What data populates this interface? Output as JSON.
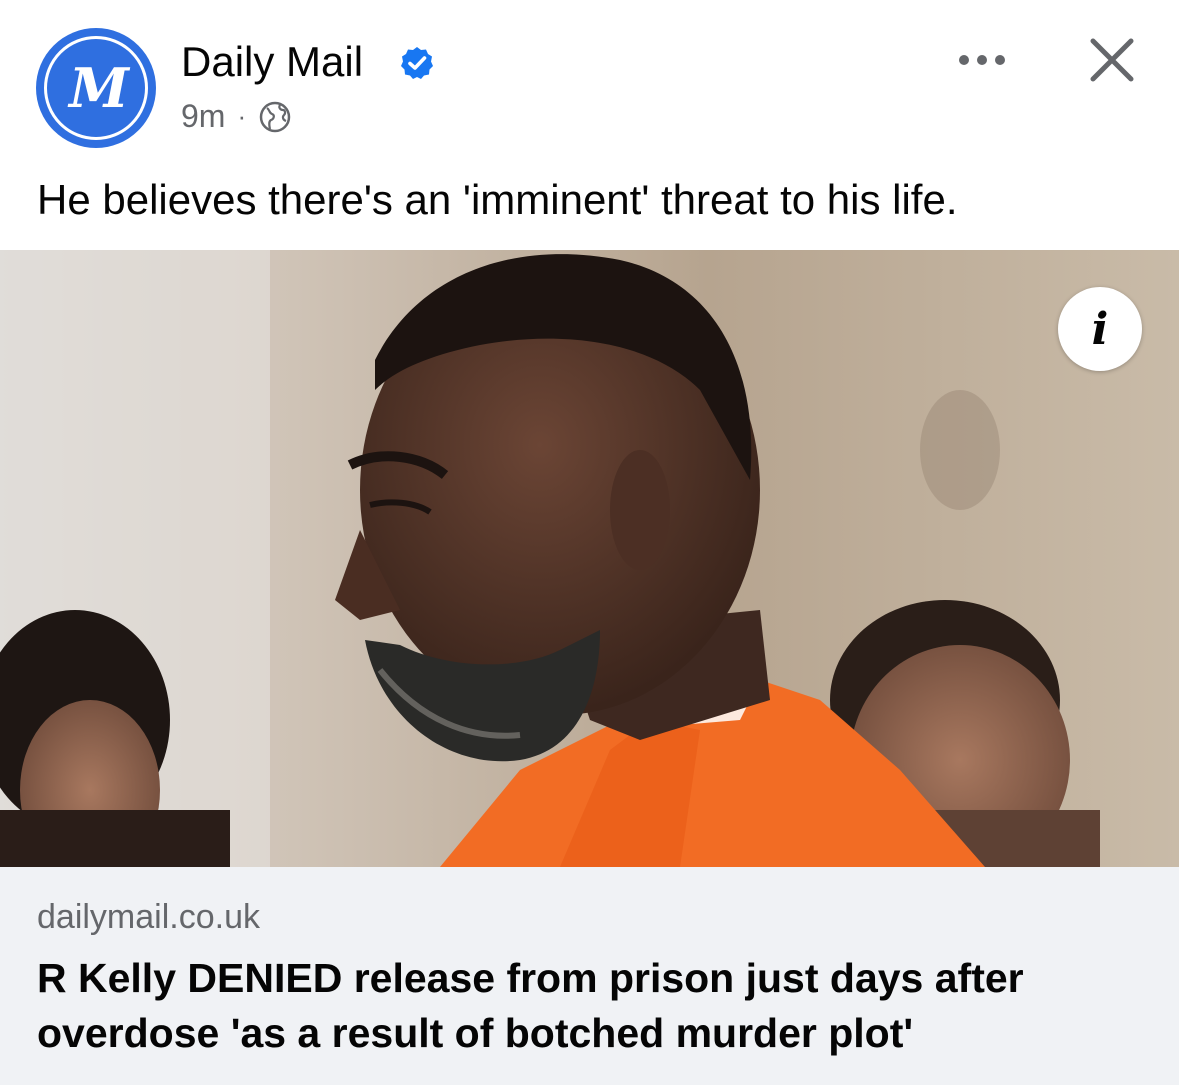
{
  "post": {
    "page_name": "Daily Mail",
    "avatar_letters": "M",
    "verified_icon": "verified-badge-icon",
    "time": "9m",
    "separator": "·",
    "audience_icon": "globe-icon",
    "more_icon": "more-options-icon",
    "close_icon": "close-icon",
    "caption": "He believes there's an 'imminent' threat to his life."
  },
  "link_preview": {
    "info_label": "i",
    "domain": "dailymail.co.uk",
    "headline": "R Kelly DENIED release from prison just days after overdose 'as a result of botched murder plot'"
  },
  "colors": {
    "brand_blue": "#2f6fe0",
    "verified_blue": "#1877f2",
    "meta_gray": "#65676b",
    "preview_bg": "#f0f2f5"
  }
}
